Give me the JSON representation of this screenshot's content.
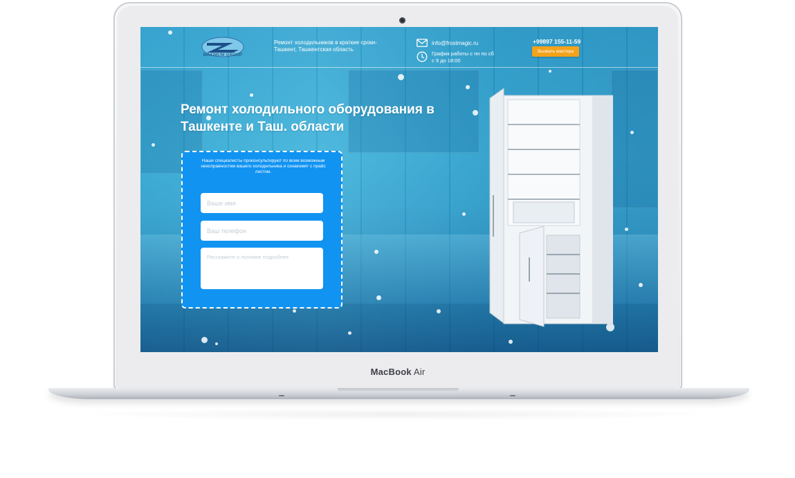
{
  "laptop": {
    "brand_bold": "MacBook",
    "brand_regular": "Air"
  },
  "site": {
    "logo_text": "MAXIMUM GROUP",
    "tagline": "Ремонт холодильников в краткие сроки- Ташкент, Ташкентская область",
    "email": "info@frostmagic.ru",
    "schedule": "График работы с пн по сб с 9 до 18:00",
    "phone": "+99897 155-11-59",
    "call_button": "Вызвать мастера",
    "hero_title": "Ремонт холодильного оборудования в Ташкенте и Таш. области",
    "form": {
      "description": "Наши специалисты проконсультируют по всем возможным неисправностям вашего холодильника и ознакомят с прайс листом.",
      "name_placeholder": "Ваше имя",
      "phone_placeholder": "Ваш телефон",
      "message_placeholder": "Расскажите о поломке подробнее"
    }
  },
  "colors": {
    "accent_orange": "#f3a21b",
    "form_blue": "#1193f2"
  }
}
